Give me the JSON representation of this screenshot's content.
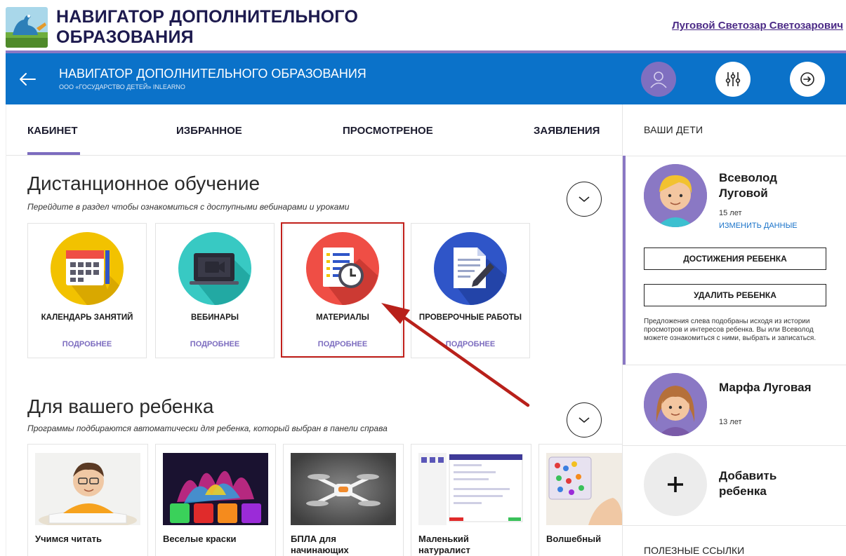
{
  "site": {
    "title": "НАВИГАТОР ДОПОЛНИТЕЛЬНОГО ОБРАЗОВАНИЯ",
    "user_name": "Луговой Светозар Светозарович"
  },
  "bar": {
    "title": "НАВИГАТОР ДОПОЛНИТЕЛЬНОГО ОБРАЗОВАНИЯ",
    "subtitle": "ООО «ГОСУДАРСТВО ДЕТЕЙ» INLEARNO",
    "icons": [
      "arrow-left-icon",
      "user-icon",
      "filter-sliders-icon",
      "logout-icon"
    ]
  },
  "tabs": [
    {
      "label": "КАБИНЕТ",
      "active": true
    },
    {
      "label": "ИЗБРАННОЕ",
      "active": false
    },
    {
      "label": "ПРОСМОТРЕНОЕ",
      "active": false
    },
    {
      "label": "ЗАЯВЛЕНИЯ",
      "active": false
    }
  ],
  "distance": {
    "title": "Дистанционное обучение",
    "description": "Перейдите в раздел чтобы ознакомиться с доступными вебинарами и уроками",
    "cards": [
      {
        "label": "КАЛЕНДАРЬ ЗАНЯТИЙ",
        "more": "ПОДРОБНЕЕ",
        "icon": "calendar-icon",
        "color": "#f2c200"
      },
      {
        "label": "ВЕБИНАРЫ",
        "more": "ПОДРОБНЕЕ",
        "icon": "webinar-camera-icon",
        "color": "#38c9c3"
      },
      {
        "label": "МАТЕРИАЛЫ",
        "more": "ПОДРОБНЕЕ",
        "icon": "materials-clock-icon",
        "color": "#ef4e45"
      },
      {
        "label": "ПРОВЕРОЧНЫЕ РАБОТЫ",
        "more": "ПОДРОБНЕЕ",
        "icon": "test-document-icon",
        "color": "#2f55c8"
      }
    ]
  },
  "for_child": {
    "title": "Для вашего ребенка",
    "description": "Программы подбираются автоматически для ребенка, который выбран в панели справа",
    "programs": [
      {
        "title": "Учимся читать"
      },
      {
        "title": "Веселые краски"
      },
      {
        "title": "БПЛА для начинающих"
      },
      {
        "title": "Маленький натуралист"
      },
      {
        "title": "Волшебный"
      }
    ]
  },
  "side": {
    "heading": "ВАШИ ДЕТИ",
    "children": [
      {
        "name": "Всеволод Луговой",
        "age": "15 лет",
        "edit": "ИЗМЕНИТЬ ДАННЫЕ"
      },
      {
        "name": "Марфа Луговая",
        "age": "13 лет"
      }
    ],
    "achievements_button": "ДОСТИЖЕНИЯ РЕБЕНКА",
    "delete_button": "УДАЛИТЬ РЕБЕНКА",
    "note": "Предложения слева подобраны исходя из истории просмотров и интересов ребенка. Вы или Всеволод можете ознакомиться с ними, выбрать и записаться.",
    "add_child": "Добавить ребенка",
    "links_heading": "ПОЛЕЗНЫЕ ССЫЛКИ"
  },
  "colors": {
    "brand_blue": "#0b72c9",
    "accent_purple": "#7c6cbf",
    "highlight_red": "#c1201b"
  }
}
